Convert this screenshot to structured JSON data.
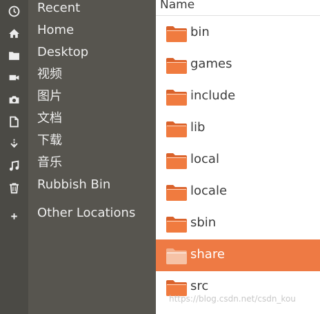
{
  "sidebar": {
    "items": [
      {
        "label": "Recent",
        "icon": "clock-icon"
      },
      {
        "label": "Home",
        "icon": "home-icon"
      },
      {
        "label": "Desktop",
        "icon": "folder-icon"
      },
      {
        "label": "视频",
        "icon": "video-icon"
      },
      {
        "label": "图片",
        "icon": "camera-icon"
      },
      {
        "label": "文档",
        "icon": "document-icon"
      },
      {
        "label": "下载",
        "icon": "download-icon"
      },
      {
        "label": "音乐",
        "icon": "music-icon"
      },
      {
        "label": "Rubbish Bin",
        "icon": "trash-icon"
      },
      {
        "label": "Other Locations",
        "icon": "plus-icon"
      }
    ]
  },
  "files": {
    "column_header": "Name",
    "rows": [
      {
        "name": "bin",
        "selected": false
      },
      {
        "name": "games",
        "selected": false
      },
      {
        "name": "include",
        "selected": false
      },
      {
        "name": "lib",
        "selected": false
      },
      {
        "name": "local",
        "selected": false
      },
      {
        "name": "locale",
        "selected": false
      },
      {
        "name": "sbin",
        "selected": false
      },
      {
        "name": "share",
        "selected": true
      },
      {
        "name": "src",
        "selected": false
      }
    ]
  },
  "watermark": "https://blog.csdn.net/csdn_kou",
  "colors": {
    "sidebar_bg": "#57554f",
    "selection": "#ee7a44",
    "folder_orange": "#f07b3f"
  }
}
